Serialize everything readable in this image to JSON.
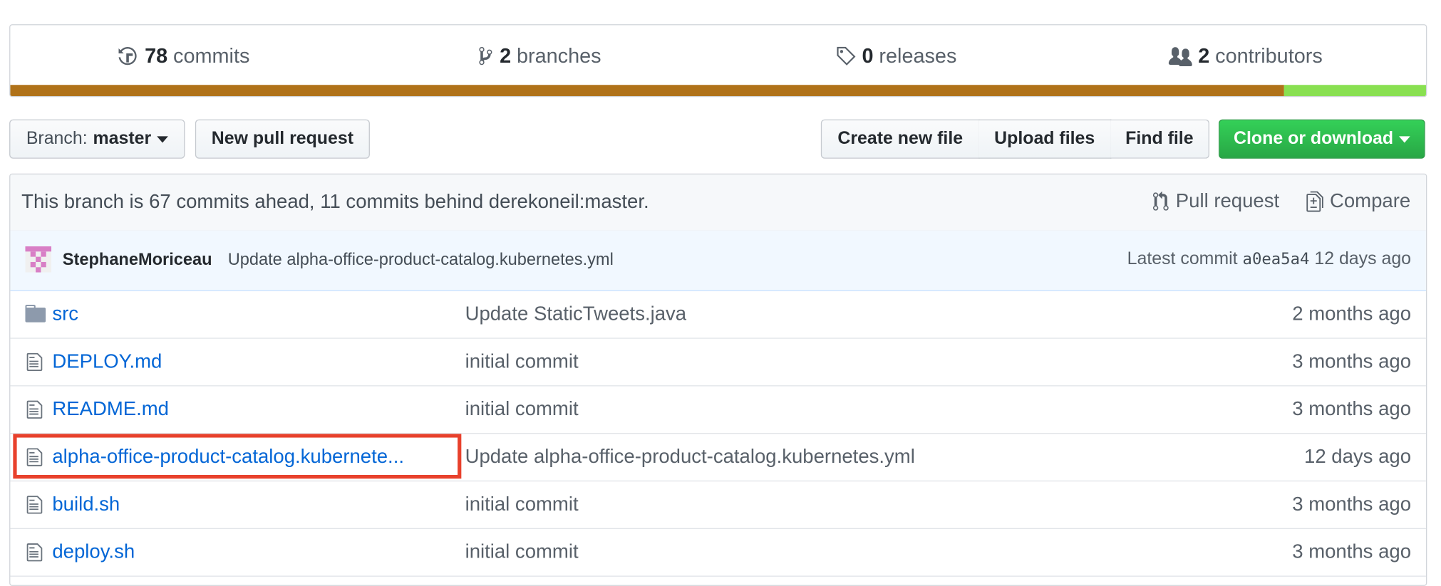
{
  "summary": {
    "commits": {
      "count": "78",
      "label": "commits",
      "icon": "history-icon"
    },
    "branches": {
      "count": "2",
      "label": "branches",
      "icon": "git-branch-icon"
    },
    "releases": {
      "count": "0",
      "label": "releases",
      "icon": "tag-icon"
    },
    "contributors": {
      "count": "2",
      "label": "contributors",
      "icon": "people-icon"
    },
    "language_bar": [
      {
        "fraction": 0.9,
        "color": "#b07219"
      },
      {
        "fraction": 0.1,
        "color": "#89e051"
      }
    ]
  },
  "toolbar": {
    "branch_prefix": "Branch:",
    "branch_name": "master",
    "new_pull_request": "New pull request",
    "create_new_file": "Create new file",
    "upload_files": "Upload files",
    "find_file": "Find file",
    "clone_or_download": "Clone or download"
  },
  "branch_info": {
    "message": "This branch is 67 commits ahead, 11 commits behind derekoneil:master.",
    "pull_request": "Pull request",
    "compare": "Compare"
  },
  "latest_commit": {
    "author": "StephaneMoriceau",
    "message": "Update alpha-office-product-catalog.kubernetes.yml",
    "prefix": "Latest commit",
    "sha": "a0ea5a4",
    "age": "12 days ago"
  },
  "files": [
    {
      "type": "dir",
      "icon": "folder-icon",
      "name": "src",
      "message": "Update StaticTweets.java",
      "age": "2 months ago"
    },
    {
      "type": "file",
      "icon": "file-icon",
      "name": "DEPLOY.md",
      "message": "initial commit",
      "age": "3 months ago"
    },
    {
      "type": "file",
      "icon": "file-icon",
      "name": "README.md",
      "message": "initial commit",
      "age": "3 months ago"
    },
    {
      "type": "file",
      "icon": "file-icon",
      "name": "alpha-office-product-catalog.kubernete...",
      "message": "Update alpha-office-product-catalog.kubernetes.yml",
      "age": "12 days ago"
    },
    {
      "type": "file",
      "icon": "file-icon",
      "name": "build.sh",
      "message": "initial commit",
      "age": "3 months ago"
    },
    {
      "type": "file",
      "icon": "file-icon",
      "name": "deploy.sh",
      "message": "initial commit",
      "age": "3 months ago"
    }
  ]
}
